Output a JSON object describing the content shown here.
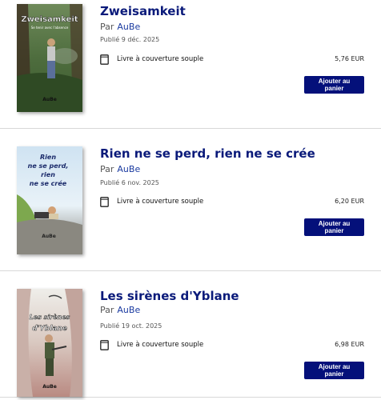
{
  "books": [
    {
      "title": "Zweisamkeit",
      "by_prefix": "Par",
      "author": "AuBe",
      "published": "Publié 9 déc. 2025",
      "format": "Livre à couverture souple",
      "price": "5,76 EUR",
      "button": "Ajouter au panier",
      "cover": {
        "title": "Zweisamkeit",
        "subtitle": "Se tenir avec l'absence",
        "author": "AuBe"
      }
    },
    {
      "title": "Rien ne se perd, rien ne se crée",
      "by_prefix": "Par",
      "author": "AuBe",
      "published": "Publié 6 nov. 2025",
      "format": "Livre à couverture souple",
      "price": "6,20 EUR",
      "button": "Ajouter au panier",
      "cover": {
        "title_lines": [
          "Rien",
          "ne se perd,",
          "rien",
          "ne se crée"
        ],
        "author": "AuBe"
      }
    },
    {
      "title": "Les sirènes d'Yblane",
      "by_prefix": "Par",
      "author": "AuBe",
      "published": "Publié 19 oct. 2025",
      "format": "Livre à couverture souple",
      "price": "6,98 EUR",
      "button": "Ajouter au panier",
      "cover": {
        "title_lines": [
          "Les sirènes",
          "d'Yblane"
        ],
        "author": "AuBe"
      }
    }
  ],
  "icons": {
    "format": "book-icon"
  }
}
